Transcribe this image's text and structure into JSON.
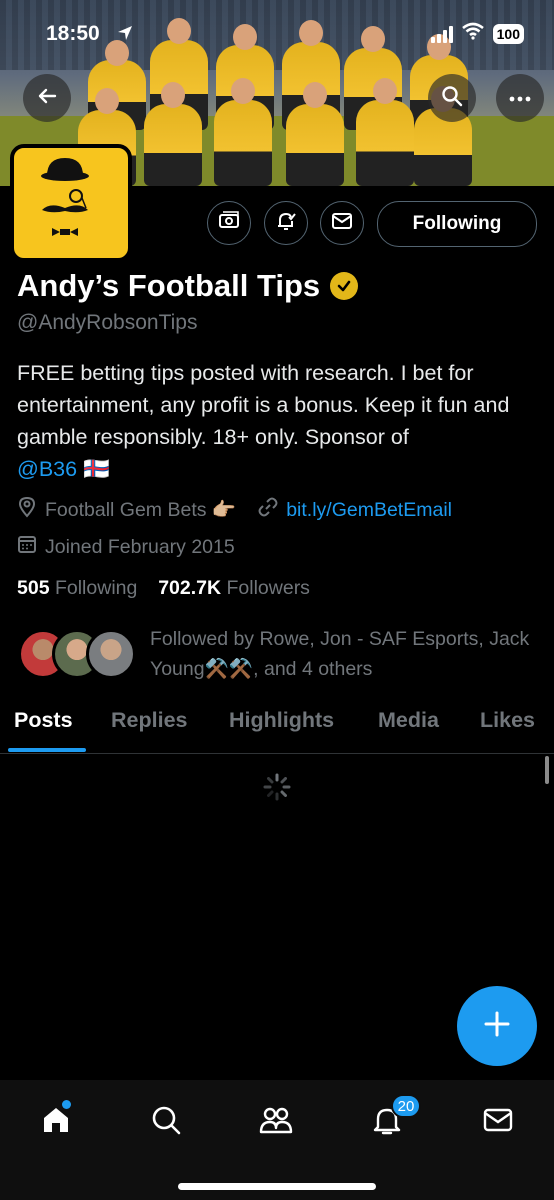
{
  "status_bar": {
    "time": "18:50",
    "battery": "100"
  },
  "profile": {
    "display_name": "Andy’s Football Tips",
    "handle": "@AndyRobsonTips",
    "bio_text": "FREE betting tips posted with research. I bet for entertainment, any profit is a bonus. Keep it fun and gamble responsibly. 18+ only. Sponsor of ",
    "bio_mention": "@B36",
    "bio_flag": "🇫🇴",
    "location": "Football Gem Bets 👉🏼",
    "website": "bit.ly/GemBetEmail",
    "joined": "Joined February 2015",
    "following_count": "505",
    "following_label": "Following",
    "followers_count": "702.7K",
    "followers_label": "Followers",
    "followed_by": "Followed by Rowe, Jon - SAF Esports, Jack Young⚒️⚒️, and 4 others"
  },
  "actions": {
    "follow_label": "Following"
  },
  "tabs": [
    {
      "label": "Posts"
    },
    {
      "label": "Replies"
    },
    {
      "label": "Highlights"
    },
    {
      "label": "Media"
    },
    {
      "label": "Likes"
    }
  ],
  "notifications_badge": "20",
  "colors": {
    "accent": "#1d9bf0",
    "verified": "#e2b719",
    "background": "#000000"
  }
}
